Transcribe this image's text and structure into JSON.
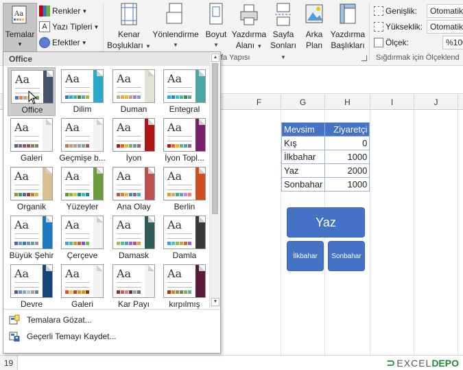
{
  "ribbon": {
    "temalar": "Temalar",
    "renkler": "Renkler",
    "yazi_tipleri": "Yazı Tipleri",
    "efektler": "Efektler",
    "kenar_line1": "Kenar",
    "kenar_line2": "Boşlukları",
    "yonlendirme": "Yönlendirme",
    "boyut": "Boyut",
    "yazdirma_alani_line1": "Yazdırma",
    "yazdirma_alani_line2": "Alanı",
    "sayfa_sonlari_line1": "Sayfa",
    "sayfa_sonlari_line2": "Sonları",
    "arka_plan_line1": "Arka",
    "arka_plan_line2": "Plan",
    "yazdirma_basliklari_line1": "Yazdırma",
    "yazdirma_basliklari_line2": "Başlıkları",
    "sayfa_yapisi_group": "fa Yapısı",
    "genislik_label": "Genişlik:",
    "genislik_value": "Otomatik",
    "yukseklik_label": "Yükseklik:",
    "yukseklik_value": "Otomatik",
    "olcek_label": "Ölçek:",
    "olcek_value": "%100",
    "sigdir_group": "Sığdırmak için Ölçeklend"
  },
  "sheet": {
    "columns": [
      "F",
      "G",
      "H",
      "I",
      "J"
    ],
    "row_number": "19",
    "table": {
      "headers": [
        "Mevsim",
        "Ziyaretçi"
      ],
      "rows": [
        {
          "mevsim": "Kış",
          "ziyaretci": "0"
        },
        {
          "mevsim": "İlkbahar",
          "ziyaretci": "1000"
        },
        {
          "mevsim": "Yaz",
          "ziyaretci": "2000"
        },
        {
          "mevsim": "Sonbahar",
          "ziyaretci": "1000"
        }
      ]
    },
    "smartart": {
      "top": "Yaz",
      "left": "İlkbahar",
      "right": "Sonbahar"
    }
  },
  "theme_panel": {
    "section_title": "Office",
    "themes": [
      {
        "name": "Office",
        "bar": "#44546a",
        "swatches": [
          "#4472c4",
          "#ed7d31",
          "#a5a5a5",
          "#ffc000",
          "#5b9bd5",
          "#70ad47"
        ]
      },
      {
        "name": "Dilim",
        "bar": "#2aa9c9",
        "swatches": [
          "#2a7bc9",
          "#1cade4",
          "#42ba97",
          "#3e8853",
          "#62a39f",
          "#a6b727"
        ]
      },
      {
        "name": "Duman",
        "bar": "#dfe3d5",
        "swatches": [
          "#a5b592",
          "#f3a447",
          "#e7bc29",
          "#d092a7",
          "#9c85c0",
          "#809ec2"
        ]
      },
      {
        "name": "Entegral",
        "bar": "#4aa8a4",
        "swatches": [
          "#1cade4",
          "#2683c6",
          "#27ced7",
          "#42ba97",
          "#3e8853",
          "#62a39f"
        ]
      },
      {
        "name": "Galeri",
        "bar": "#f2f2f2",
        "swatches": [
          "#5a5a8c",
          "#7d5a8c",
          "#8c5a6e",
          "#a05050",
          "#a07850",
          "#7a8c5a"
        ]
      },
      {
        "name": "Geçmişe b...",
        "bar": "#f2f2f2",
        "swatches": [
          "#b07d56",
          "#c69c6d",
          "#a3a3a3",
          "#8c9fb3",
          "#8ca87a",
          "#a35a5a"
        ]
      },
      {
        "name": "İyon",
        "bar": "#b01513",
        "swatches": [
          "#b01513",
          "#ea6312",
          "#e6b729",
          "#6aac90",
          "#5f9c9d",
          "#9e5e9b"
        ]
      },
      {
        "name": "İyon Topl...",
        "bar": "#7a1f6e",
        "swatches": [
          "#b01513",
          "#ea6312",
          "#e6b729",
          "#6aac90",
          "#5f9c9d",
          "#9e5e9b"
        ]
      },
      {
        "name": "Organik",
        "bar": "#dcbf8f",
        "swatches": [
          "#83992a",
          "#3c9770",
          "#44709d",
          "#a23c33",
          "#d97828",
          "#deb340"
        ]
      },
      {
        "name": "Yüzeyler",
        "bar": "#6b9d3f",
        "swatches": [
          "#549e39",
          "#8ab833",
          "#c0cf3a",
          "#029676",
          "#4ab5c4",
          "#0989b1"
        ]
      },
      {
        "name": "Ana Olay",
        "bar": "#c0504d",
        "swatches": [
          "#c0504d",
          "#e2803a",
          "#f0b445",
          "#4f81bd",
          "#8064a2",
          "#4bacc6"
        ]
      },
      {
        "name": "Berlin",
        "bar": "#d04f1e",
        "swatches": [
          "#f09415",
          "#c1b56b",
          "#4baf73",
          "#5aa6c0",
          "#d17df9",
          "#fa7e5c"
        ]
      },
      {
        "name": "Büyük Şehir",
        "bar": "#1b7ac0",
        "swatches": [
          "#4a66ac",
          "#629dd1",
          "#297fd5",
          "#7f8fa9",
          "#5aa2ae",
          "#9d90a0"
        ]
      },
      {
        "name": "Çerçeve",
        "bar": "#f2f2f2",
        "swatches": [
          "#40a1c4",
          "#40c4a0",
          "#c4a040",
          "#c46040",
          "#a040c4",
          "#60c440"
        ]
      },
      {
        "name": "Damask",
        "bar": "#2e5e5c",
        "swatches": [
          "#9ec544",
          "#50bea3",
          "#4a9ccc",
          "#9a66ca",
          "#c54f71",
          "#de9c3c"
        ]
      },
      {
        "name": "Damla",
        "bar": "#3a3a3a",
        "swatches": [
          "#2fa3ee",
          "#4bcaad",
          "#86c157",
          "#d99c3f",
          "#ce6633",
          "#a35dd1"
        ]
      },
      {
        "name": "Devre",
        "bar": "#16457a",
        "swatches": [
          "#4c5d8a",
          "#6b8cc7",
          "#7fa8c3",
          "#a5c4d5",
          "#a2a2a2",
          "#7c7c7c"
        ]
      },
      {
        "name": "Galeri",
        "bar": "#f2f2f2",
        "swatches": [
          "#e84c22",
          "#ffbd47",
          "#b64926",
          "#ff8427",
          "#cc9900",
          "#b22600"
        ]
      },
      {
        "name": "Kar Payı",
        "bar": "#f2f2f2",
        "swatches": [
          "#8e2c2c",
          "#c95a5a",
          "#d68181",
          "#5a3a3a",
          "#a39e9e",
          "#6d6d6d"
        ]
      },
      {
        "name": "kırpılmış",
        "bar": "#5b1a3a",
        "swatches": [
          "#a53010",
          "#de7e18",
          "#9f8351",
          "#728653",
          "#92aa4c",
          "#6aac91"
        ]
      }
    ],
    "browse_label": "Temalara Gözat...",
    "save_label": "Geçerli Temayı Kaydet..."
  },
  "logo": {
    "text_dark": "EXCEL",
    "text_accent": "DEPO"
  }
}
